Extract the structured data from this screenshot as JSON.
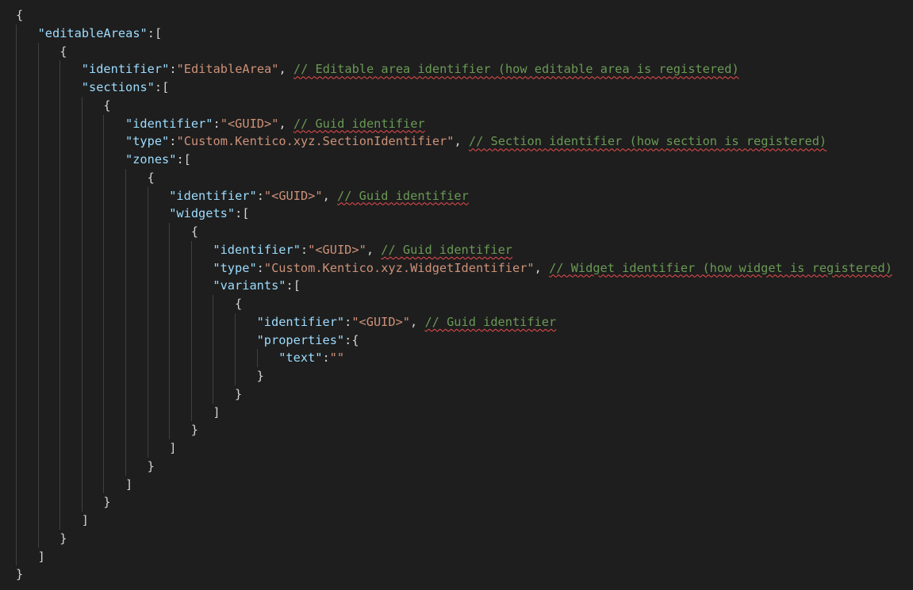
{
  "editor": {
    "language": "json",
    "colors": {
      "background": "#1e1e1e",
      "punctuation": "#d4d4d4",
      "key": "#9cdcfe",
      "string": "#ce9178",
      "comment": "#6a9955",
      "squiggle": "#f14c4c",
      "indent_guide": "#404040"
    },
    "lines": [
      {
        "indent": 0,
        "tokens": [
          {
            "t": "punct",
            "v": "{"
          }
        ]
      },
      {
        "indent": 1,
        "tokens": [
          {
            "t": "key",
            "v": "\"editableAreas\""
          },
          {
            "t": "punct",
            "v": ":["
          }
        ]
      },
      {
        "indent": 2,
        "tokens": [
          {
            "t": "punct",
            "v": "{"
          }
        ]
      },
      {
        "indent": 3,
        "tokens": [
          {
            "t": "key",
            "v": "\"identifier\""
          },
          {
            "t": "punct",
            "v": ":"
          },
          {
            "t": "str",
            "v": "\"EditableArea\""
          },
          {
            "t": "punct",
            "v": ", "
          },
          {
            "t": "comment",
            "v": "// Editable area identifier (how editable area is registered)"
          }
        ]
      },
      {
        "indent": 3,
        "tokens": [
          {
            "t": "key",
            "v": "\"sections\""
          },
          {
            "t": "punct",
            "v": ":["
          }
        ]
      },
      {
        "indent": 4,
        "tokens": [
          {
            "t": "punct",
            "v": "{"
          }
        ]
      },
      {
        "indent": 5,
        "tokens": [
          {
            "t": "key",
            "v": "\"identifier\""
          },
          {
            "t": "punct",
            "v": ":"
          },
          {
            "t": "str",
            "v": "\"<GUID>\""
          },
          {
            "t": "punct",
            "v": ", "
          },
          {
            "t": "comment",
            "v": "// Guid identifier"
          }
        ]
      },
      {
        "indent": 5,
        "tokens": [
          {
            "t": "key",
            "v": "\"type\""
          },
          {
            "t": "punct",
            "v": ":"
          },
          {
            "t": "str",
            "v": "\"Custom.Kentico.xyz.SectionIdentifier\""
          },
          {
            "t": "punct",
            "v": ", "
          },
          {
            "t": "comment",
            "v": "// Section identifier (how section is registered)"
          }
        ]
      },
      {
        "indent": 5,
        "tokens": [
          {
            "t": "key",
            "v": "\"zones\""
          },
          {
            "t": "punct",
            "v": ":["
          }
        ]
      },
      {
        "indent": 6,
        "tokens": [
          {
            "t": "punct",
            "v": "{"
          }
        ]
      },
      {
        "indent": 7,
        "tokens": [
          {
            "t": "key",
            "v": "\"identifier\""
          },
          {
            "t": "punct",
            "v": ":"
          },
          {
            "t": "str",
            "v": "\"<GUID>\""
          },
          {
            "t": "punct",
            "v": ", "
          },
          {
            "t": "comment",
            "v": "// Guid identifier"
          }
        ]
      },
      {
        "indent": 7,
        "tokens": [
          {
            "t": "key",
            "v": "\"widgets\""
          },
          {
            "t": "punct",
            "v": ":["
          }
        ]
      },
      {
        "indent": 8,
        "tokens": [
          {
            "t": "punct",
            "v": "{"
          }
        ]
      },
      {
        "indent": 9,
        "tokens": [
          {
            "t": "key",
            "v": "\"identifier\""
          },
          {
            "t": "punct",
            "v": ":"
          },
          {
            "t": "str",
            "v": "\"<GUID>\""
          },
          {
            "t": "punct",
            "v": ", "
          },
          {
            "t": "comment",
            "v": "// Guid identifier"
          }
        ]
      },
      {
        "indent": 9,
        "tokens": [
          {
            "t": "key",
            "v": "\"type\""
          },
          {
            "t": "punct",
            "v": ":"
          },
          {
            "t": "str",
            "v": "\"Custom.Kentico.xyz.WidgetIdentifier\""
          },
          {
            "t": "punct",
            "v": ", "
          },
          {
            "t": "comment",
            "v": "// Widget identifier (how widget is registered)"
          }
        ]
      },
      {
        "indent": 9,
        "tokens": [
          {
            "t": "key",
            "v": "\"variants\""
          },
          {
            "t": "punct",
            "v": ":["
          }
        ]
      },
      {
        "indent": 10,
        "tokens": [
          {
            "t": "punct",
            "v": "{"
          }
        ]
      },
      {
        "indent": 11,
        "tokens": [
          {
            "t": "key",
            "v": "\"identifier\""
          },
          {
            "t": "punct",
            "v": ":"
          },
          {
            "t": "str",
            "v": "\"<GUID>\""
          },
          {
            "t": "punct",
            "v": ", "
          },
          {
            "t": "comment",
            "v": "// Guid identifier"
          }
        ]
      },
      {
        "indent": 11,
        "tokens": [
          {
            "t": "key",
            "v": "\"properties\""
          },
          {
            "t": "punct",
            "v": ":{"
          }
        ]
      },
      {
        "indent": 12,
        "tokens": [
          {
            "t": "key",
            "v": "\"text\""
          },
          {
            "t": "punct",
            "v": ":"
          },
          {
            "t": "str",
            "v": "\"\""
          }
        ]
      },
      {
        "indent": 11,
        "tokens": [
          {
            "t": "punct",
            "v": "}"
          }
        ]
      },
      {
        "indent": 10,
        "tokens": [
          {
            "t": "punct",
            "v": "}"
          }
        ]
      },
      {
        "indent": 9,
        "tokens": [
          {
            "t": "punct",
            "v": "]"
          }
        ]
      },
      {
        "indent": 8,
        "tokens": [
          {
            "t": "punct",
            "v": "}"
          }
        ]
      },
      {
        "indent": 7,
        "tokens": [
          {
            "t": "punct",
            "v": "]"
          }
        ]
      },
      {
        "indent": 6,
        "tokens": [
          {
            "t": "punct",
            "v": "}"
          }
        ]
      },
      {
        "indent": 5,
        "tokens": [
          {
            "t": "punct",
            "v": "]"
          }
        ]
      },
      {
        "indent": 4,
        "tokens": [
          {
            "t": "punct",
            "v": "}"
          }
        ]
      },
      {
        "indent": 3,
        "tokens": [
          {
            "t": "punct",
            "v": "]"
          }
        ]
      },
      {
        "indent": 2,
        "tokens": [
          {
            "t": "punct",
            "v": "}"
          }
        ]
      },
      {
        "indent": 1,
        "tokens": [
          {
            "t": "punct",
            "v": "]"
          }
        ]
      },
      {
        "indent": 0,
        "tokens": [
          {
            "t": "punct",
            "v": "}"
          }
        ]
      }
    ]
  }
}
